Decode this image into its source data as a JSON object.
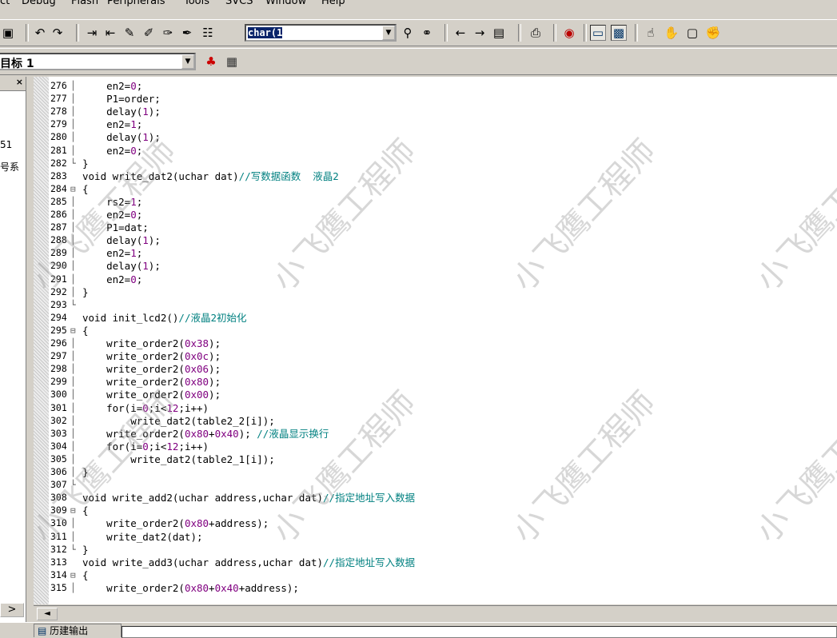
{
  "menu": [
    "ct",
    "Debug",
    "Flash",
    "Peripherals",
    "Tools",
    "SVCS",
    "Window",
    "Help"
  ],
  "toolbar": {
    "find_combo_value": "char(1",
    "target_combo_value": "目标 1"
  },
  "left_panel": {
    "close_label": "×",
    "text_1": "51",
    "text_2": "号系",
    "scroll_label": ">"
  },
  "editor": {
    "lines": [
      {
        "n": "276",
        "fold": "│",
        "code": "    en2=<n>0</n>;"
      },
      {
        "n": "277",
        "fold": "│",
        "code": "    P1=order;"
      },
      {
        "n": "278",
        "fold": "│",
        "code": "    delay(<n>1</n>);"
      },
      {
        "n": "279",
        "fold": "│",
        "code": "    en2=<n>1</n>;"
      },
      {
        "n": "280",
        "fold": "│",
        "code": "    delay(<n>1</n>);"
      },
      {
        "n": "281",
        "fold": "│",
        "code": "    en2=<n>0</n>;"
      },
      {
        "n": "282",
        "fold": "└",
        "code": "}"
      },
      {
        "n": "283",
        "fold": "",
        "code": "void write_dat2(uchar dat)<c>//写数据函数  液晶2</c>"
      },
      {
        "n": "284",
        "fold": "⊟",
        "code": "{"
      },
      {
        "n": "285",
        "fold": "│",
        "code": "    rs2=<n>1</n>;"
      },
      {
        "n": "286",
        "fold": "│",
        "code": "    en2=<n>0</n>;"
      },
      {
        "n": "287",
        "fold": "│",
        "code": "    P1=dat;"
      },
      {
        "n": "288",
        "fold": "│",
        "code": "    delay(<n>1</n>);"
      },
      {
        "n": "289",
        "fold": "│",
        "code": "    en2=<n>1</n>;"
      },
      {
        "n": "290",
        "fold": "│",
        "code": "    delay(<n>1</n>);"
      },
      {
        "n": "291",
        "fold": "│",
        "code": "    en2=<n>0</n>;"
      },
      {
        "n": "292",
        "fold": "│",
        "code": "}"
      },
      {
        "n": "293",
        "fold": "└",
        "code": ""
      },
      {
        "n": "294",
        "fold": "",
        "code": "void init_lcd2()<c>//液晶2初始化</c>"
      },
      {
        "n": "295",
        "fold": "⊟",
        "code": "{"
      },
      {
        "n": "296",
        "fold": "│",
        "code": "    write_order2(<n>0x38</n>);"
      },
      {
        "n": "297",
        "fold": "│",
        "code": "    write_order2(<n>0x0c</n>);"
      },
      {
        "n": "298",
        "fold": "│",
        "code": "    write_order2(<n>0x06</n>);"
      },
      {
        "n": "299",
        "fold": "│",
        "code": "    write_order2(<n>0x80</n>);"
      },
      {
        "n": "300",
        "fold": "│",
        "code": "    write_order2(<n>0x00</n>);"
      },
      {
        "n": "301",
        "fold": "│",
        "code": "    for(i=<n>0</n>;i<<n>12</n>;i++)"
      },
      {
        "n": "302",
        "fold": "│",
        "code": "        write_dat2(table2_2[i]);"
      },
      {
        "n": "303",
        "fold": "│",
        "code": "    write_order2(<n>0x80</n>+<n>0x40</n>); <c>//液晶显示换行</c>"
      },
      {
        "n": "304",
        "fold": "│",
        "code": "    for(i=<n>0</n>;i<<n>12</n>;i++)"
      },
      {
        "n": "305",
        "fold": "│",
        "code": "        write_dat2(table2_1[i]);"
      },
      {
        "n": "306",
        "fold": "│",
        "code": "}"
      },
      {
        "n": "307",
        "fold": "└",
        "code": ""
      },
      {
        "n": "308",
        "fold": "",
        "code": "void write_add2(uchar address,uchar dat)<c>//指定地址写入数据</c>"
      },
      {
        "n": "309",
        "fold": "⊟",
        "code": "{"
      },
      {
        "n": "310",
        "fold": "│",
        "code": "    write_order2(<n>0x80</n>+address);"
      },
      {
        "n": "311",
        "fold": "│",
        "code": "    write_dat2(dat);"
      },
      {
        "n": "312",
        "fold": "└",
        "code": "}"
      },
      {
        "n": "313",
        "fold": "",
        "code": "void write_add3(uchar address,uchar dat)<c>//指定地址写入数据</c>"
      },
      {
        "n": "314",
        "fold": "⊟",
        "code": "{"
      },
      {
        "n": "315",
        "fold": "│",
        "code": "    write_order2(<n>0x80</n>+<n>0x40</n>+address);"
      }
    ]
  },
  "hscroll": {
    "left_arrow": "◄"
  },
  "status": {
    "tab_label": "历建输出"
  },
  "watermark": "小飞鹰工程师",
  "icons": {
    "binoculars": "binoculars-icon",
    "print": "print-icon",
    "debug": "debug-icon"
  }
}
